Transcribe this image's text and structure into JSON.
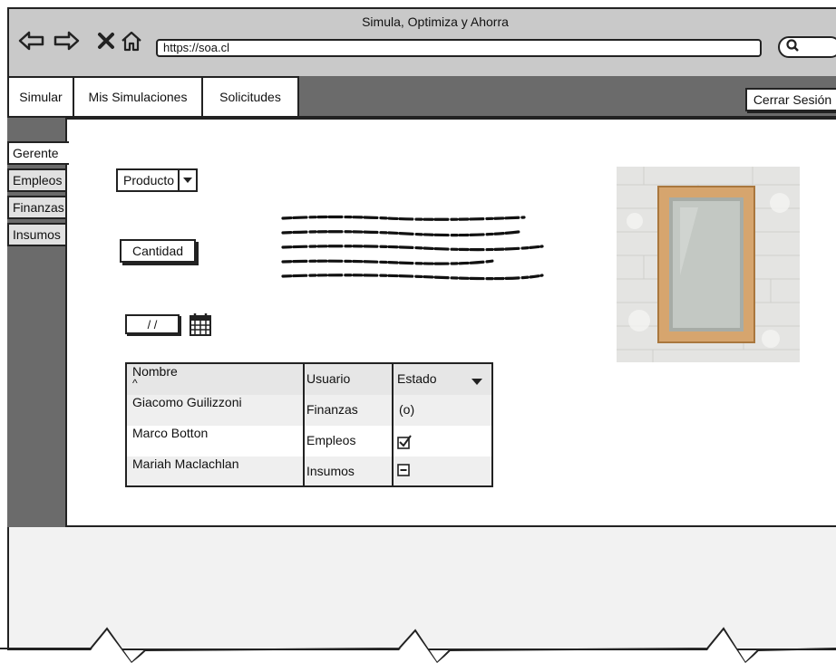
{
  "window": {
    "title": "Simula, Optimiza y Ahorra",
    "url": "https://soa.cl"
  },
  "nav": {
    "tabs": [
      {
        "label": "Simular"
      },
      {
        "label": "Mis Simulaciones"
      },
      {
        "label": "Solicitudes"
      }
    ],
    "logout_label": "Cerrar Sesión"
  },
  "sidebar": {
    "items": [
      {
        "label": "Gerente",
        "active": true
      },
      {
        "label": "Empleos"
      },
      {
        "label": "Finanzas"
      },
      {
        "label": "Insumos"
      }
    ]
  },
  "form": {
    "product_select": "Producto",
    "quantity_button": "Cantidad",
    "date_value": "/ /"
  },
  "table": {
    "columns": [
      "Nombre",
      "Usuario",
      "Estado"
    ],
    "sort_indicator": "^",
    "rows": [
      {
        "name": "Giacomo Guilizzoni",
        "user": "Finanzas",
        "status": "(o)"
      },
      {
        "name": "Marco Botton",
        "user": "Empleos",
        "status": "checkbox-checked"
      },
      {
        "name": "Mariah Maclachlan",
        "user": "Insumos",
        "status": "checkbox-indeterminate"
      }
    ]
  },
  "icons": {
    "back": "arrow-left-icon",
    "forward": "arrow-right-icon",
    "close": "close-icon",
    "home": "home-icon",
    "search": "search-icon",
    "calendar": "calendar-icon"
  },
  "colors": {
    "chrome": "#c9c9c9",
    "bar": "#6b6b6b",
    "page": "#f2f2f2"
  }
}
